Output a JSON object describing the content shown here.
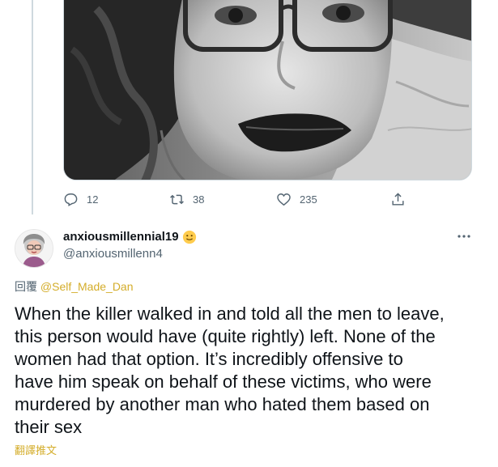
{
  "original_tweet": {
    "actions": {
      "reply_count": "12",
      "retweet_count": "38",
      "like_count": "235"
    }
  },
  "reply": {
    "display_name": "anxiousmillennial19",
    "handle": "@anxiousmillenn4",
    "replying_to_prefix": "回覆",
    "replying_to_mention": "@Self_Made_Dan",
    "text": "When the killer walked in and told all the men to leave,\nthis person would have (quite rightly) left. None of the\nwomen had that option. It’s incredibly offensive to\nhave him speak on behalf of these victims, who were\nmurdered by another man who hated them based on\ntheir sex",
    "translate_label": "翻譯推文"
  },
  "colors": {
    "accent_link": "#d4ad2a",
    "secondary_text": "#536471",
    "border": "#cfd9de"
  },
  "icons": {
    "reply": "reply-icon",
    "retweet": "retweet-icon",
    "like": "heart-icon",
    "share": "share-icon",
    "more": "more-icon",
    "emoji": "slightly-smiling-face-icon"
  }
}
